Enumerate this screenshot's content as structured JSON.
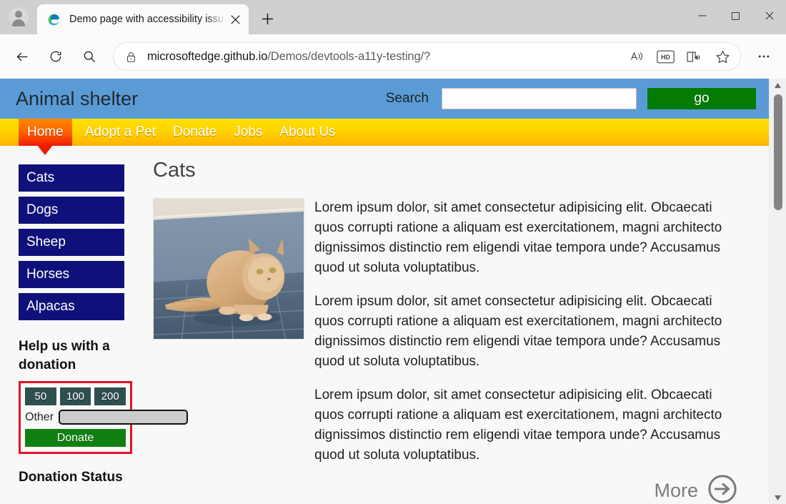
{
  "browser": {
    "profile_icon": "person-avatar-icon",
    "tab": {
      "title": "Demo page with accessibility issu",
      "favicon": "edge-logo-icon",
      "close_label": "✕"
    },
    "new_tab_label": "+",
    "window_controls": {
      "minimize": "—",
      "maximize": "☐",
      "close": "✕"
    },
    "nav": {
      "back_icon": "arrow-left-icon",
      "refresh_icon": "reload-icon",
      "search_icon": "magnifier-icon"
    },
    "address_bar": {
      "lock_icon": "padlock-icon",
      "url_domain": "microsoftedge.github.io",
      "url_path": "/Demos/devtools-a11y-testing/?"
    },
    "toolbar_icons": {
      "read_aloud": "read-aloud-icon",
      "hd_badge": "HD",
      "immersive_reader": "immersive-reader-icon",
      "favorites": "star-icon",
      "settings_more": "•••"
    }
  },
  "site": {
    "title": "Animal shelter",
    "search": {
      "label": "Search",
      "value": "",
      "placeholder": "",
      "go_label": "go",
      "go_color": "#047c04"
    },
    "nav_items": [
      {
        "label": "Home",
        "active": true
      },
      {
        "label": "Adopt a Pet",
        "active": false
      },
      {
        "label": "Donate",
        "active": false
      },
      {
        "label": "Jobs",
        "active": false
      },
      {
        "label": "About Us",
        "active": false
      }
    ],
    "sidebar": {
      "categories": [
        {
          "label": "Cats"
        },
        {
          "label": "Dogs"
        },
        {
          "label": "Sheep"
        },
        {
          "label": "Horses"
        },
        {
          "label": "Alpacas"
        }
      ],
      "category_color": "#10107a",
      "donation": {
        "heading": "Help us with a donation",
        "highlight_color": "#e81123",
        "amounts": [
          "50",
          "100",
          "200"
        ],
        "other_label": "Other",
        "other_value": "",
        "donate_label": "Donate",
        "donate_color": "#108010"
      },
      "status_heading": "Donation Status"
    },
    "content": {
      "heading": "Cats",
      "photo_alt": "cat-photo",
      "paragraphs": [
        "Lorem ipsum dolor, sit amet consectetur adipisicing elit. Obcaecati quos corrupti ratione a aliquam est exercitationem, magni architecto dignissimos distinctio rem eligendi vitae tempora unde? Accusamus quod ut soluta voluptatibus.",
        "Lorem ipsum dolor, sit amet consectetur adipisicing elit. Obcaecati quos corrupti ratione a aliquam est exercitationem, magni architecto dignissimos distinctio rem eligendi vitae tempora unde? Accusamus quod ut soluta voluptatibus.",
        "Lorem ipsum dolor, sit amet consectetur adipisicing elit. Obcaecati quos corrupti ratione a aliquam est exercitationem, magni architecto dignissimos distinctio rem eligendi vitae tempora unde? Accusamus quod ut soluta voluptatibus."
      ],
      "more_label": "More",
      "more_icon": "arrow-right-circle-icon"
    }
  }
}
